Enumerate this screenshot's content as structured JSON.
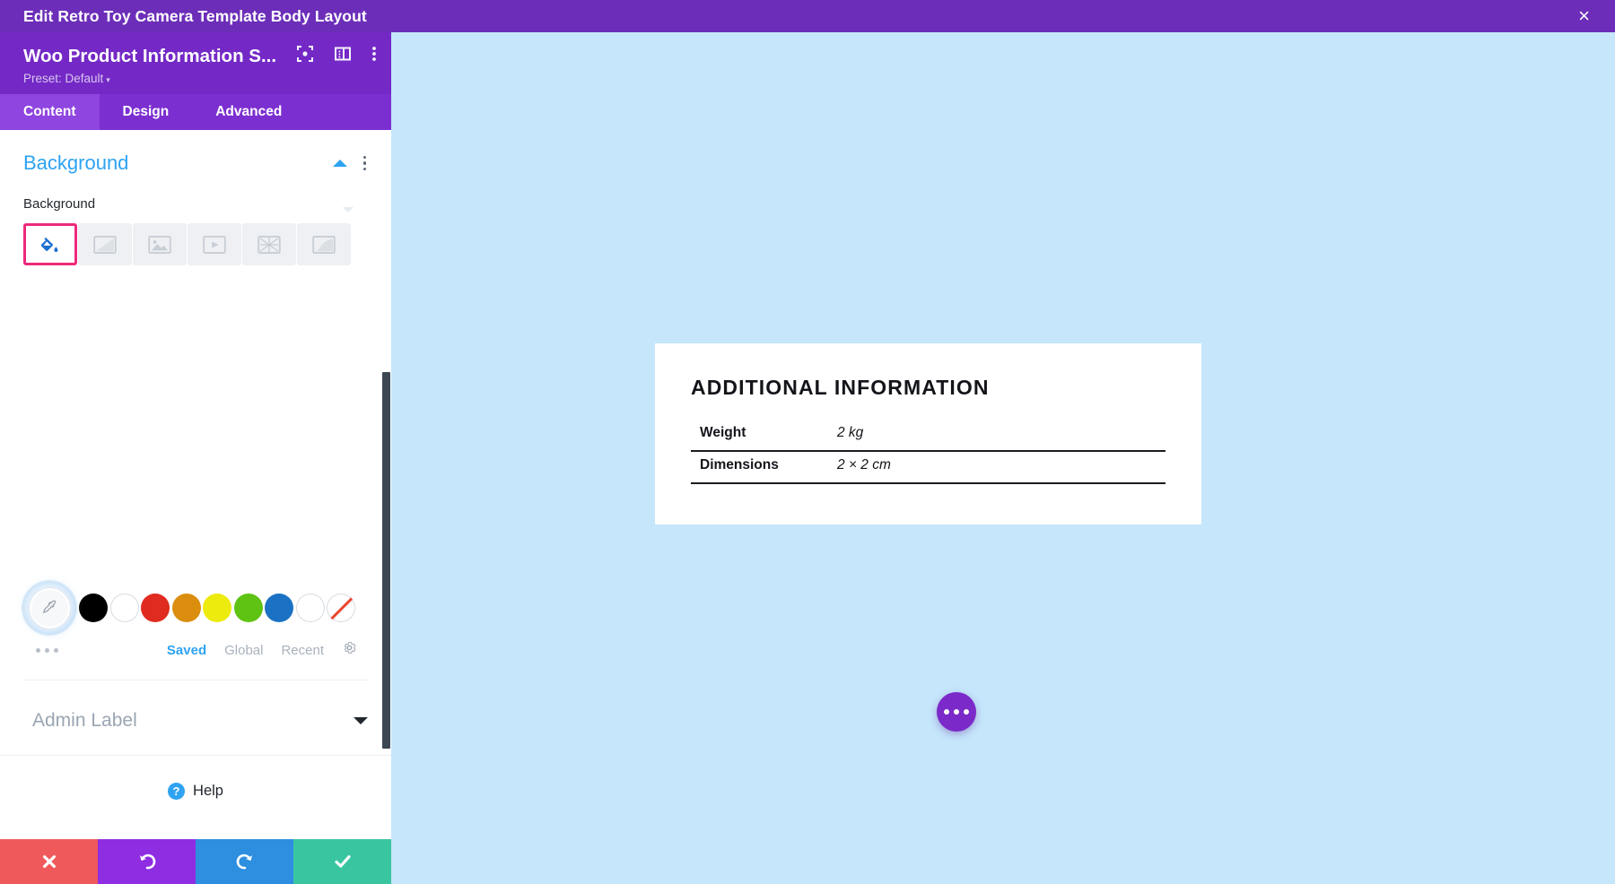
{
  "titlebar": {
    "title": "Edit Retro Toy Camera Template Body Layout",
    "close_label": "×"
  },
  "panel": {
    "module_title": "Woo Product Information S...",
    "preset_label": "Preset: Default",
    "preset_caret": "▾",
    "icons": {
      "focus": "focus-target-icon",
      "layout": "panel-layout-icon",
      "kebab": "more-options-icon"
    },
    "tabs": [
      {
        "label": "Content",
        "active": true
      },
      {
        "label": "Design",
        "active": false
      },
      {
        "label": "Advanced",
        "active": false
      }
    ],
    "background_section": {
      "title": "Background",
      "field_label": "Background",
      "type_tabs": [
        {
          "name": "background-color-tab",
          "icon": "paint-bucket-icon",
          "active": true
        },
        {
          "name": "background-gradient-tab",
          "icon": "gradient-icon",
          "active": false
        },
        {
          "name": "background-image-tab",
          "icon": "image-icon",
          "active": false
        },
        {
          "name": "background-video-tab",
          "icon": "video-icon",
          "active": false
        },
        {
          "name": "background-pattern-tab",
          "icon": "pattern-icon",
          "active": false
        },
        {
          "name": "background-mask-tab",
          "icon": "mask-icon",
          "active": false
        }
      ],
      "swatches": [
        {
          "name": "eyedropper",
          "color": "#f7f8fa",
          "selected": true
        },
        {
          "name": "black",
          "color": "#000000"
        },
        {
          "name": "white",
          "color": "#ffffff"
        },
        {
          "name": "red",
          "color": "#e02b20"
        },
        {
          "name": "orange",
          "color": "#db8e0e"
        },
        {
          "name": "yellow",
          "color": "#edea0d"
        },
        {
          "name": "green",
          "color": "#5fc川"
        },
        {
          "name": "blue",
          "color": "#1b72c4"
        },
        {
          "name": "white-2",
          "color": "#ffffff"
        },
        {
          "name": "transparent",
          "color": "none"
        }
      ],
      "palette_tabs": [
        {
          "label": "Saved",
          "active": true
        },
        {
          "label": "Global",
          "active": false
        },
        {
          "label": "Recent",
          "active": false
        }
      ],
      "settings_icon": "gear-icon",
      "more_colors_icon": "more-dots-icon"
    },
    "admin_label_section": {
      "title": "Admin Label"
    },
    "help": {
      "label": "Help",
      "badge": "?"
    },
    "actions": [
      {
        "name": "cancel-button",
        "icon": "✖",
        "color": "#f0595c"
      },
      {
        "name": "undo-button",
        "icon": "↺",
        "color": "#8e2de2"
      },
      {
        "name": "redo-button",
        "icon": "↻",
        "color": "#2e8ee0"
      },
      {
        "name": "save-button",
        "icon": "✔",
        "color": "#3ac5a1"
      }
    ]
  },
  "canvas": {
    "background_color": "#c5e6fb",
    "product_card": {
      "heading": "ADDITIONAL INFORMATION",
      "rows": [
        {
          "label": "Weight",
          "value": "2 kg"
        },
        {
          "label": "Dimensions",
          "value": "2 × 2 cm"
        }
      ]
    },
    "fab": {
      "name": "page-settings-fab",
      "icon": "three-dots-icon",
      "color": "#7b29c9"
    }
  }
}
